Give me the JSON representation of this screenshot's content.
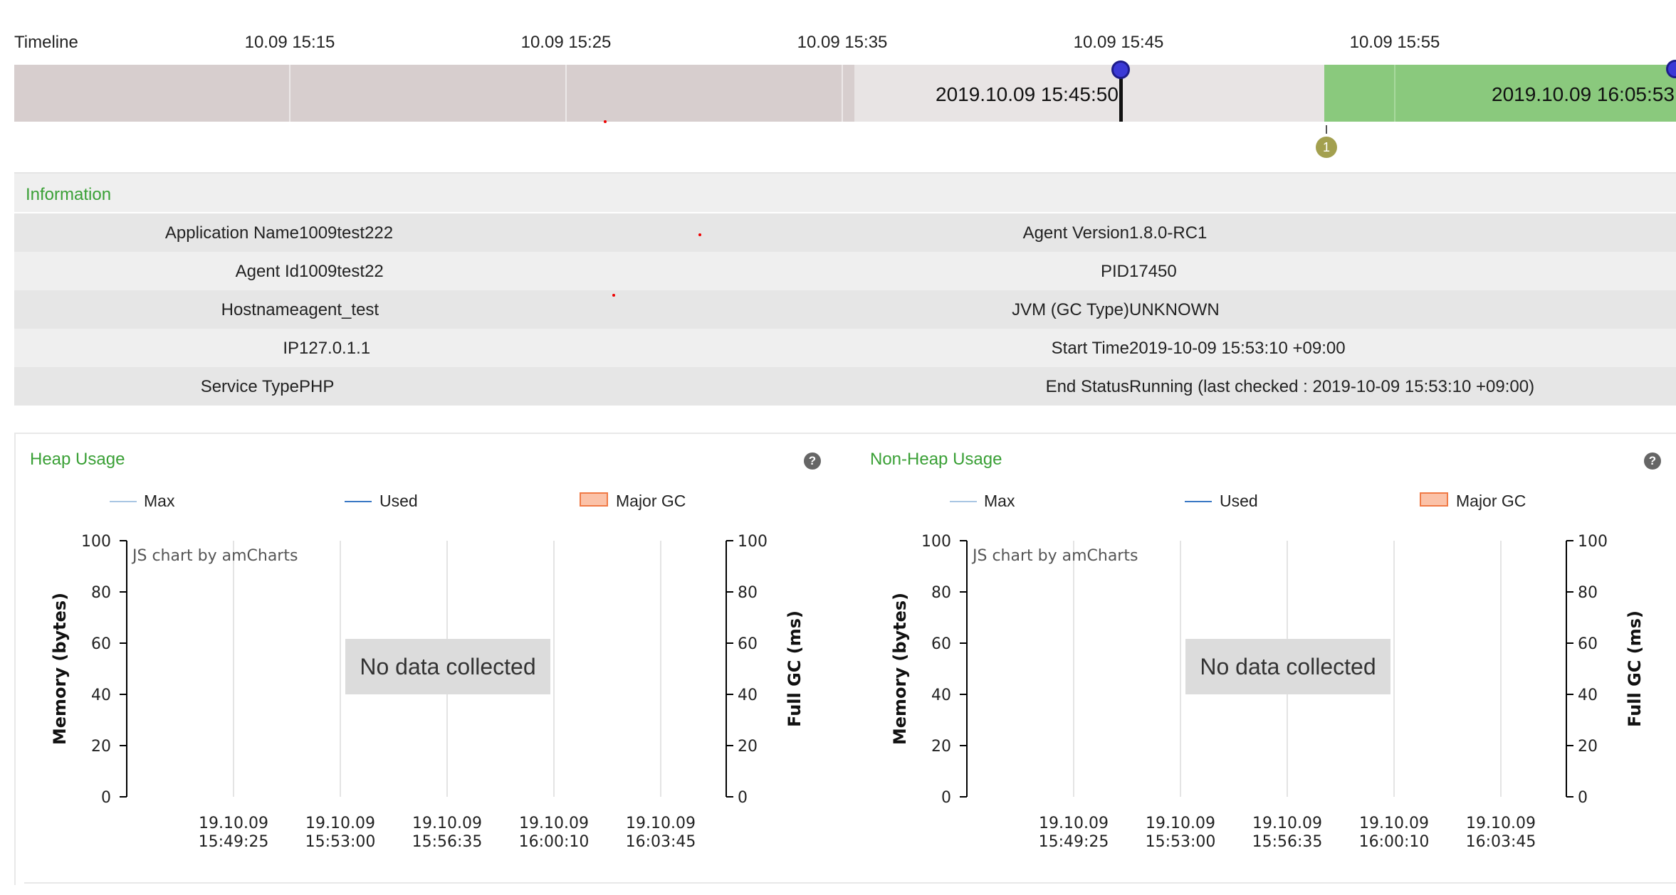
{
  "timeline": {
    "label": "Timeline",
    "ticks": [
      "10.09 15:15",
      "10.09 15:25",
      "10.09 15:35",
      "10.09 15:45",
      "10.09 15:55"
    ],
    "selection_start": "2019.10.09 15:45:50",
    "selection_end": "2019.10.09 16:05:53",
    "event_count": "1"
  },
  "info": {
    "title": "Information",
    "rows": [
      {
        "left_label": "Application Name",
        "left_value": "1009test222",
        "right_label": "Agent Version",
        "right_value": "1.8.0-RC1"
      },
      {
        "left_label": "Agent Id",
        "left_value": "1009test22",
        "right_label": "PID",
        "right_value": "17450"
      },
      {
        "left_label": "Hostname",
        "left_value": "agent_test",
        "right_label": "JVM (GC Type)",
        "right_value": "UNKNOWN"
      },
      {
        "left_label": "IP",
        "left_value": "127.0.1.1",
        "right_label": "Start Time",
        "right_value": "2019-10-09 15:53:10 +09:00"
      },
      {
        "left_label": "Service Type",
        "left_value": "PHP",
        "right_label": "End Status",
        "right_value": "Running (last checked : 2019-10-09 15:53:10 +09:00)"
      }
    ]
  },
  "colors": {
    "accent_green": "#3aa036",
    "timeline_selected": "#8ac97d",
    "legend_max": "#a9c6e3",
    "legend_used": "#3a78c4",
    "legend_major_gc": "#fbc2a8"
  },
  "help_icon": "question-circle-icon",
  "chart_data": [
    {
      "type": "line",
      "title": "Heap Usage",
      "watermark": "JS chart by amCharts",
      "no_data_text": "No data collected",
      "series": [
        {
          "name": "Max",
          "values": []
        },
        {
          "name": "Used",
          "values": []
        },
        {
          "name": "Major GC",
          "values": []
        }
      ],
      "categories": [
        "19.10.09 15:49:25",
        "19.10.09 15:53:00",
        "19.10.09 15:56:35",
        "19.10.09 16:00:10",
        "19.10.09 16:03:45"
      ],
      "ylabel": "Memory (bytes)",
      "y2label": "Full GC (ms)",
      "ylim": [
        0,
        100
      ],
      "y2lim": [
        0,
        100
      ],
      "yticks": [
        "0",
        "20",
        "40",
        "60",
        "80",
        "100"
      ],
      "legend_position": "top",
      "grid": true
    },
    {
      "type": "line",
      "title": "Non-Heap Usage",
      "watermark": "JS chart by amCharts",
      "no_data_text": "No data collected",
      "series": [
        {
          "name": "Max",
          "values": []
        },
        {
          "name": "Used",
          "values": []
        },
        {
          "name": "Major GC",
          "values": []
        }
      ],
      "categories": [
        "19.10.09 15:49:25",
        "19.10.09 15:53:00",
        "19.10.09 15:56:35",
        "19.10.09 16:00:10",
        "19.10.09 16:03:45"
      ],
      "ylabel": "Memory (bytes)",
      "y2label": "Full GC (ms)",
      "ylim": [
        0,
        100
      ],
      "y2lim": [
        0,
        100
      ],
      "yticks": [
        "0",
        "20",
        "40",
        "60",
        "80",
        "100"
      ],
      "legend_position": "top",
      "grid": true
    }
  ]
}
